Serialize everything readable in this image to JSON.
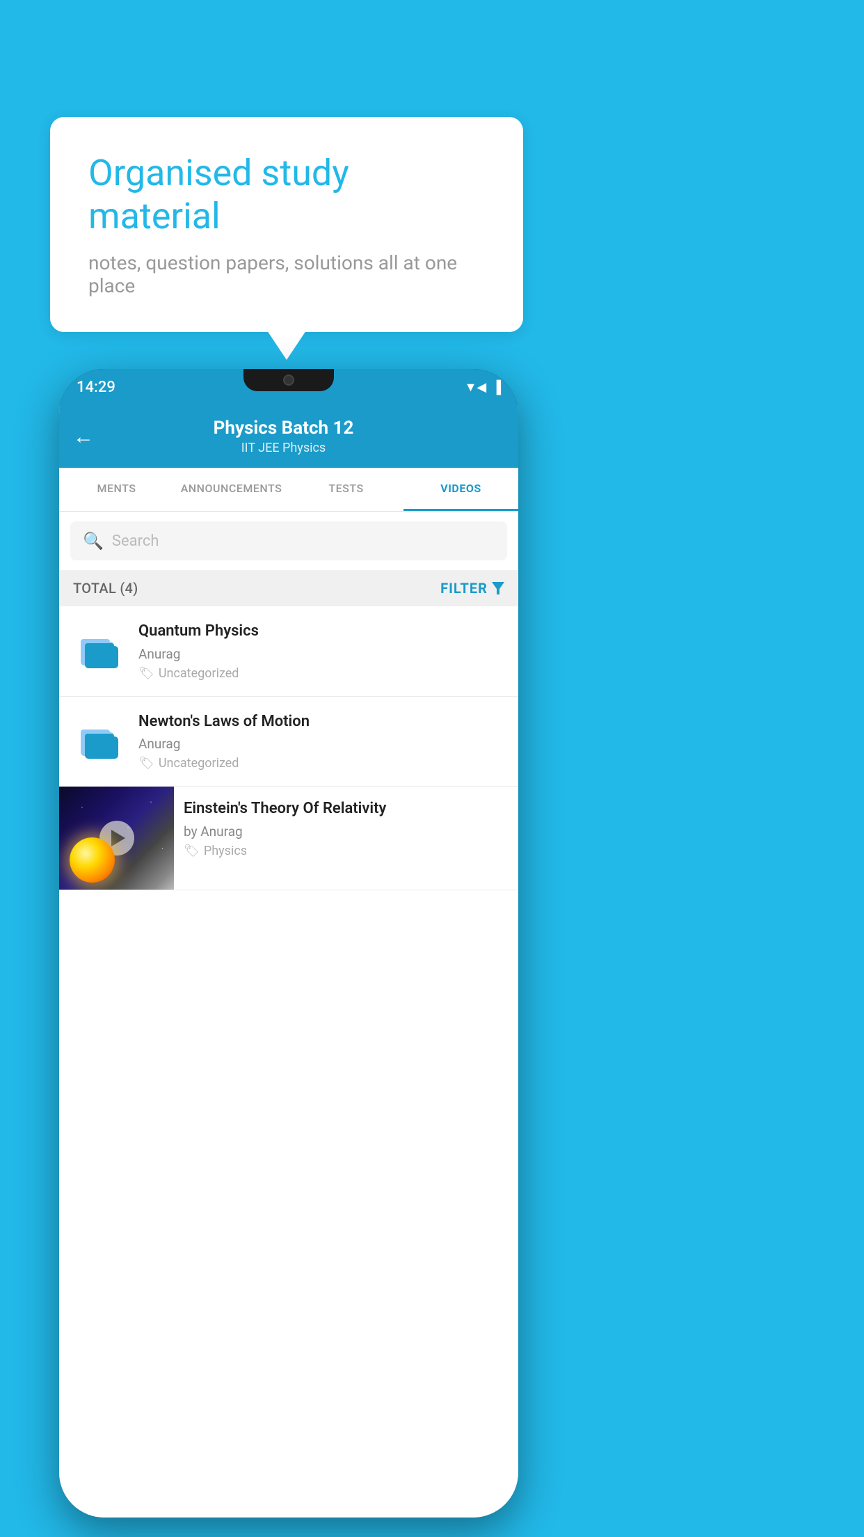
{
  "background_color": "#22B8E8",
  "bubble": {
    "title": "Organised study material",
    "subtitle": "notes, question papers, solutions all at one place"
  },
  "phone": {
    "status_bar": {
      "time": "14:29",
      "icons": [
        "wifi",
        "signal",
        "battery"
      ]
    },
    "header": {
      "title": "Physics Batch 12",
      "subtitle_tags": "IIT JEE   Physics",
      "back_label": "←"
    },
    "tabs": [
      {
        "label": "MENTS",
        "active": false
      },
      {
        "label": "ANNOUNCEMENTS",
        "active": false
      },
      {
        "label": "TESTS",
        "active": false
      },
      {
        "label": "VIDEOS",
        "active": true
      }
    ],
    "search": {
      "placeholder": "Search"
    },
    "filter_bar": {
      "total_label": "TOTAL (4)",
      "filter_label": "FILTER"
    },
    "videos": [
      {
        "id": 1,
        "title": "Quantum Physics",
        "author": "Anurag",
        "tag": "Uncategorized",
        "has_thumbnail": false
      },
      {
        "id": 2,
        "title": "Newton's Laws of Motion",
        "author": "Anurag",
        "tag": "Uncategorized",
        "has_thumbnail": false
      },
      {
        "id": 3,
        "title": "Einstein's Theory Of Relativity",
        "author": "by Anurag",
        "tag": "Physics",
        "has_thumbnail": true
      }
    ]
  }
}
